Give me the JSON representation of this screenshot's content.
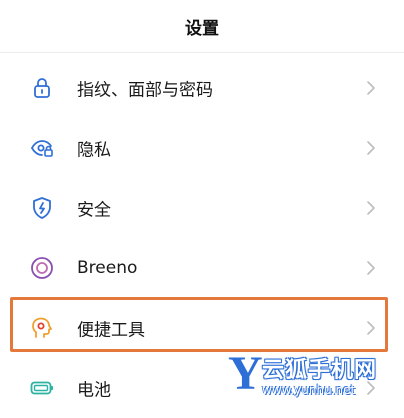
{
  "header": {
    "title": "设置"
  },
  "settings": {
    "items": [
      {
        "label": "指纹、面部与密码",
        "icon": "lock-icon"
      },
      {
        "label": "隐私",
        "icon": "privacy-eye-icon"
      },
      {
        "label": "安全",
        "icon": "shield-icon"
      },
      {
        "label": "Breeno",
        "icon": "breeno-icon"
      },
      {
        "label": "便捷工具",
        "icon": "convenience-tools-icon"
      },
      {
        "label": "电池",
        "icon": "battery-icon"
      }
    ]
  },
  "colors": {
    "icon_blue": "#2f6fd6",
    "highlight_border": "#e5793b",
    "chevron": "#bdbdbd",
    "icon_orange": "#f0a030",
    "icon_purple": "#8a4fb0",
    "icon_teal": "#2bb3a3"
  },
  "watermark": {
    "logo": "Y",
    "name": "云狐手机网",
    "url": "www.yunhu.net"
  }
}
